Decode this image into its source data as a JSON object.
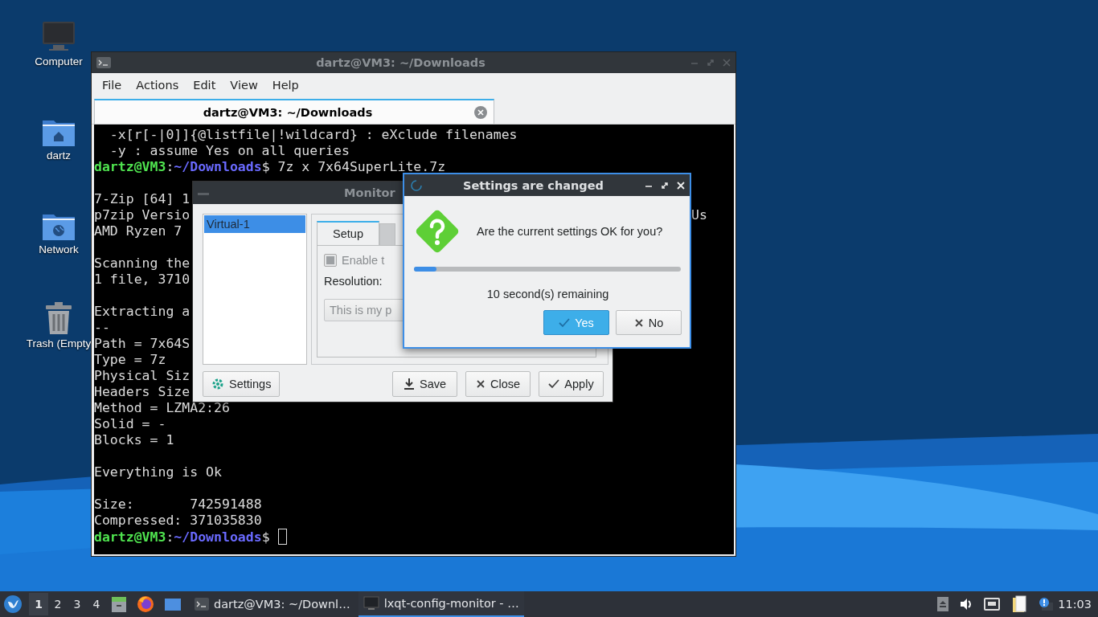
{
  "desktop_icons": [
    {
      "label": "Computer",
      "kind": "computer"
    },
    {
      "label": "dartz",
      "kind": "home"
    },
    {
      "label": "Network",
      "kind": "network"
    },
    {
      "label": "Trash (Empty",
      "kind": "trash"
    }
  ],
  "terminal": {
    "title": "dartz@VM3: ~/Downloads",
    "menu": [
      "File",
      "Actions",
      "Edit",
      "View",
      "Help"
    ],
    "tabs": [
      {
        "label": "dartz@VM3: ~/Downloads",
        "selected": true
      }
    ],
    "lines": [
      {
        "kind": "text",
        "text": "  -x[r[-|0]]{@listfile|!wildcard} : eXclude filenames"
      },
      {
        "kind": "text",
        "text": "  -y : assume Yes on all queries"
      },
      {
        "kind": "prompt",
        "user": "dartz@VM3",
        "sep": ":",
        "path": "~/Downloads",
        "command": "$ 7z x 7x64SuperLite.7z",
        "cursor": false
      },
      {
        "kind": "blank"
      },
      {
        "kind": "text",
        "text": "7-Zip [64] 1"
      },
      {
        "kind": "text",
        "text": "p7zip Versio",
        "tail": "Us"
      },
      {
        "kind": "text",
        "text": "AMD Ryzen 7"
      },
      {
        "kind": "blank"
      },
      {
        "kind": "text",
        "text": "Scanning the"
      },
      {
        "kind": "text",
        "text": "1 file, 3710"
      },
      {
        "kind": "blank"
      },
      {
        "kind": "text",
        "text": "Extracting a"
      },
      {
        "kind": "text",
        "text": "--"
      },
      {
        "kind": "text",
        "text": "Path = 7x64S"
      },
      {
        "kind": "text",
        "text": "Type = 7z"
      },
      {
        "kind": "text",
        "text": "Physical Siz"
      },
      {
        "kind": "text",
        "text": "Headers Size"
      },
      {
        "kind": "text",
        "text": "Method = LZMA2:26"
      },
      {
        "kind": "text",
        "text": "Solid = -"
      },
      {
        "kind": "text",
        "text": "Blocks = 1"
      },
      {
        "kind": "blank"
      },
      {
        "kind": "text",
        "text": "Everything is Ok"
      },
      {
        "kind": "blank"
      },
      {
        "kind": "text",
        "text": "Size:       742591488"
      },
      {
        "kind": "text",
        "text": "Compressed: 371035830"
      },
      {
        "kind": "prompt",
        "user": "dartz@VM3",
        "sep": ":",
        "path": "~/Downloads",
        "command": "$",
        "cursor": true
      }
    ]
  },
  "monitor": {
    "title": "Monitor",
    "outputs": [
      {
        "label": "Virtual-1",
        "selected": true
      }
    ],
    "tabs": [
      {
        "label": "Setup",
        "selected": true
      }
    ],
    "enable": {
      "label": "Enable t",
      "checked": false,
      "disabled": true
    },
    "resolution_label": "Resolution:",
    "combo": {
      "value": "This is my p"
    },
    "buttons": [
      {
        "label": "Settings"
      },
      {
        "label": "Save"
      },
      {
        "label": "Close"
      },
      {
        "label": "Apply"
      }
    ]
  },
  "dialog": {
    "title": "Settings are changed",
    "message": "Are the current settings OK for you?",
    "progress": {
      "level": 0.085
    },
    "remaining": "10 second(s) remaining",
    "buttons": [
      {
        "label": "Yes",
        "default": true
      },
      {
        "label": "No",
        "default": false
      }
    ]
  },
  "taskbar": {
    "desktops": [
      {
        "label": "1",
        "selected": true
      },
      {
        "label": "2",
        "selected": false
      },
      {
        "label": "3",
        "selected": false
      },
      {
        "label": "4",
        "selected": false
      }
    ],
    "tasks": [
      {
        "label": "dartz@VM3: ~/Downl…",
        "kind": "terminal",
        "selected": false
      },
      {
        "label": "lxqt-config-monitor - …",
        "kind": "monitor",
        "selected": true
      }
    ],
    "clock": "11:03"
  }
}
